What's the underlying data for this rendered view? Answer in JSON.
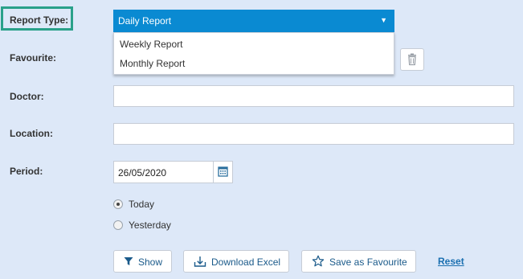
{
  "form": {
    "report_type_label": "Report Type:",
    "favourite_label": "Favourite:",
    "doctor_label": "Doctor:",
    "location_label": "Location:",
    "period_label": "Period:"
  },
  "report_type": {
    "selected": "Daily Report",
    "options": [
      "Weekly Report",
      "Monthly Report"
    ]
  },
  "doctor": {
    "value": ""
  },
  "location": {
    "value": ""
  },
  "period": {
    "date": "26/05/2020",
    "radios": [
      {
        "label": "Today",
        "checked": true
      },
      {
        "label": "Yesterday",
        "checked": false
      }
    ]
  },
  "actions": {
    "show": "Show",
    "download_excel": "Download Excel",
    "save_favourite": "Save as Favourite",
    "reset": "Reset"
  },
  "colors": {
    "background": "#dde8f8",
    "select_blue": "#0a8ad2",
    "highlight": "#2aa18a",
    "link": "#1a6fb0"
  },
  "icons": [
    "caret-down-icon",
    "trash-icon",
    "calendar-icon",
    "filter-icon",
    "download-icon",
    "star-icon"
  ]
}
